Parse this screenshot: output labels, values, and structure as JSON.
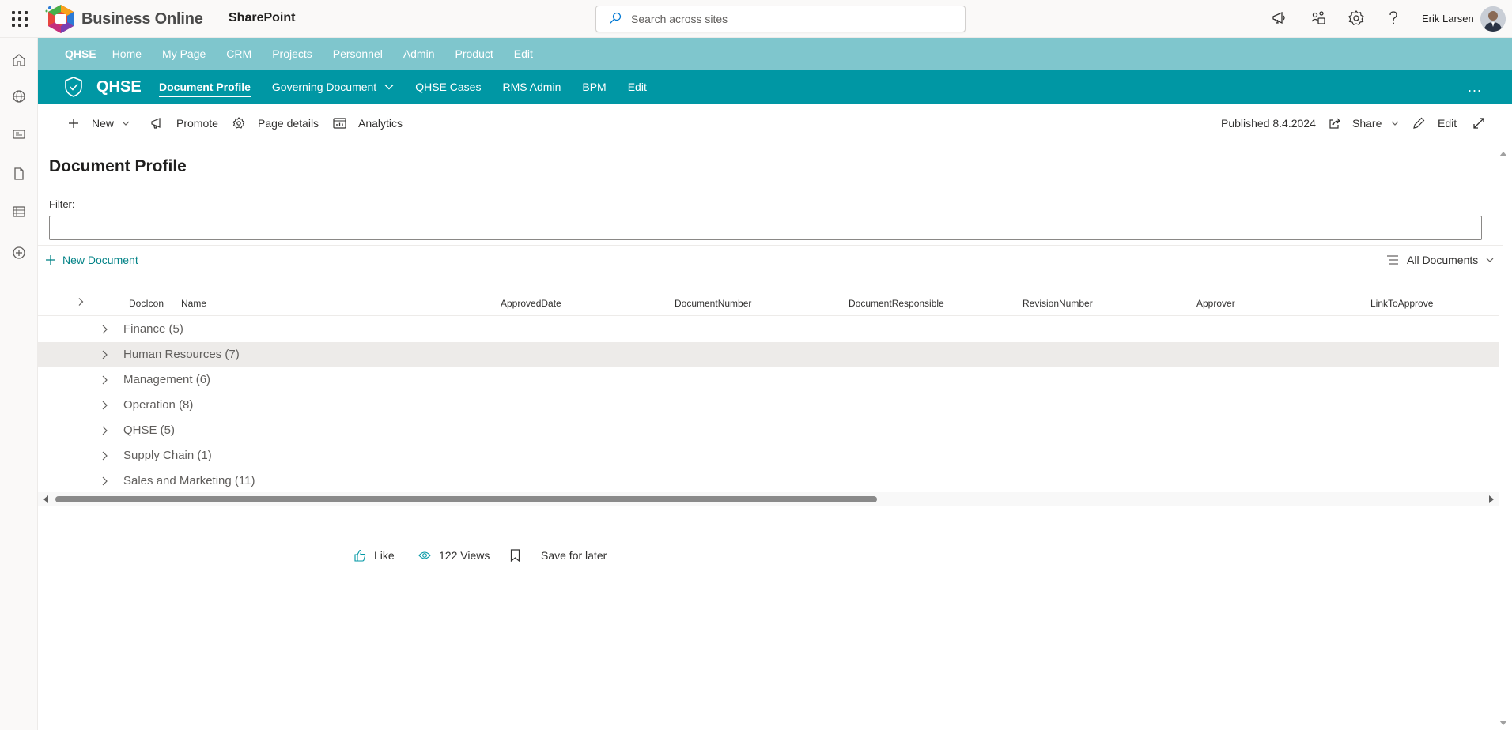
{
  "suite": {
    "brand_name": "Business Online",
    "app_name": "SharePoint",
    "search_placeholder": "Search across sites",
    "user_name": "Erik Larsen"
  },
  "hub_nav": {
    "title": "QHSE",
    "items": [
      "Home",
      "My Page",
      "CRM",
      "Projects",
      "Personnel",
      "Admin",
      "Product",
      "Edit"
    ]
  },
  "site": {
    "title": "QHSE",
    "nav": [
      {
        "label": "Document Profile",
        "active": true,
        "dropdown": false
      },
      {
        "label": "Governing Document",
        "active": false,
        "dropdown": true
      },
      {
        "label": "QHSE Cases",
        "active": false,
        "dropdown": false
      },
      {
        "label": "RMS Admin",
        "active": false,
        "dropdown": false
      },
      {
        "label": "BPM",
        "active": false,
        "dropdown": false
      },
      {
        "label": "Edit",
        "active": false,
        "dropdown": false
      }
    ],
    "more": "..."
  },
  "command_bar": {
    "new": "New",
    "promote": "Promote",
    "page_details": "Page details",
    "analytics": "Analytics",
    "published": "Published 8.4.2024",
    "share": "Share",
    "edit": "Edit"
  },
  "content": {
    "page_title": "Document Profile",
    "filter_label": "Filter:",
    "filter_value": "",
    "new_document": "New Document",
    "view_name": "All Documents",
    "columns": [
      "DocIcon",
      "Name",
      "ApprovedDate",
      "DocumentNumber",
      "DocumentResponsible",
      "RevisionNumber",
      "Approver",
      "LinkToApprove"
    ],
    "groups": [
      {
        "label": "Finance (5)",
        "hover": false
      },
      {
        "label": "Human Resources (7)",
        "hover": true
      },
      {
        "label": "Management (6)",
        "hover": false
      },
      {
        "label": "Operation (8)",
        "hover": false
      },
      {
        "label": "QHSE (5)",
        "hover": false
      },
      {
        "label": "Supply Chain (1)",
        "hover": false
      },
      {
        "label": "Sales and Marketing (11)",
        "hover": false
      }
    ]
  },
  "social": {
    "like": "Like",
    "views": "122 Views",
    "save_for_later": "Save for later"
  },
  "colors": {
    "hub_nav_bg": "#7fc6cd",
    "site_header_bg": "#0097a4",
    "accent_link": "#038387",
    "row_hover": "#edebe9"
  }
}
